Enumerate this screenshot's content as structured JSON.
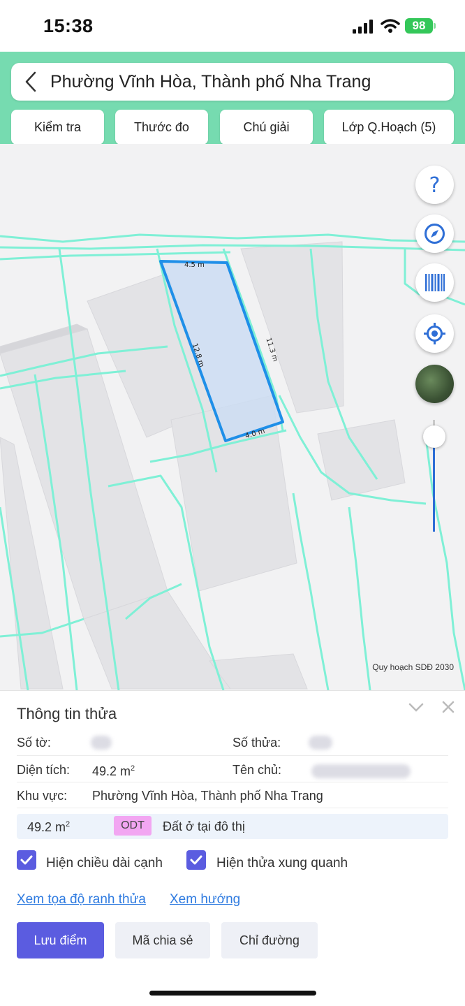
{
  "status_bar": {
    "time": "15:38",
    "battery": "98"
  },
  "header": {
    "title": "Phường Vĩnh Hòa, Thành phố Nha Trang",
    "tabs": [
      "Kiểm tra",
      "Thước đo",
      "Chú giải",
      "Lớp Q.Hoạch (5)"
    ]
  },
  "map": {
    "credit": "Quy hoạch SDĐ 2030",
    "edges": {
      "top": "4.5 m",
      "right": "11.3 m",
      "bottom": "4.0 m",
      "left": "12.8 m"
    },
    "help_symbol": "?",
    "zoom_level": 0.85,
    "colors": {
      "boundary": "#7ff0d6",
      "parcel_stroke": "#1f8fe8",
      "parcel_fill": "#cdddf2",
      "building": "#e3e3e6"
    }
  },
  "sheet": {
    "title": "Thông tin thửa",
    "fields": {
      "so_to_label": "Số tờ:",
      "so_thua_label": "Số thửa:",
      "dien_tich_label": "Diện tích:",
      "dien_tich_value": "49.2 m",
      "ten_chu_label": "Tên chủ:",
      "khu_vuc_label": "Khu vực:",
      "khu_vuc_value": "Phường Vĩnh Hòa, Thành phố Nha Trang"
    },
    "land_use": {
      "area": "49.2 m",
      "code": "ODT",
      "name": "Đất ở tại đô thị"
    },
    "area_unit_exponent": "2",
    "checkboxes": [
      {
        "label": "Hiện chiều dài cạnh",
        "checked": true
      },
      {
        "label": "Hiện thửa xung quanh",
        "checked": true
      }
    ],
    "links": [
      "Xem tọa độ ranh thửa",
      "Xem hướng"
    ],
    "buttons": {
      "save": "Lưu điểm",
      "share": "Mã chia sẻ",
      "directions": "Chỉ đường"
    }
  }
}
